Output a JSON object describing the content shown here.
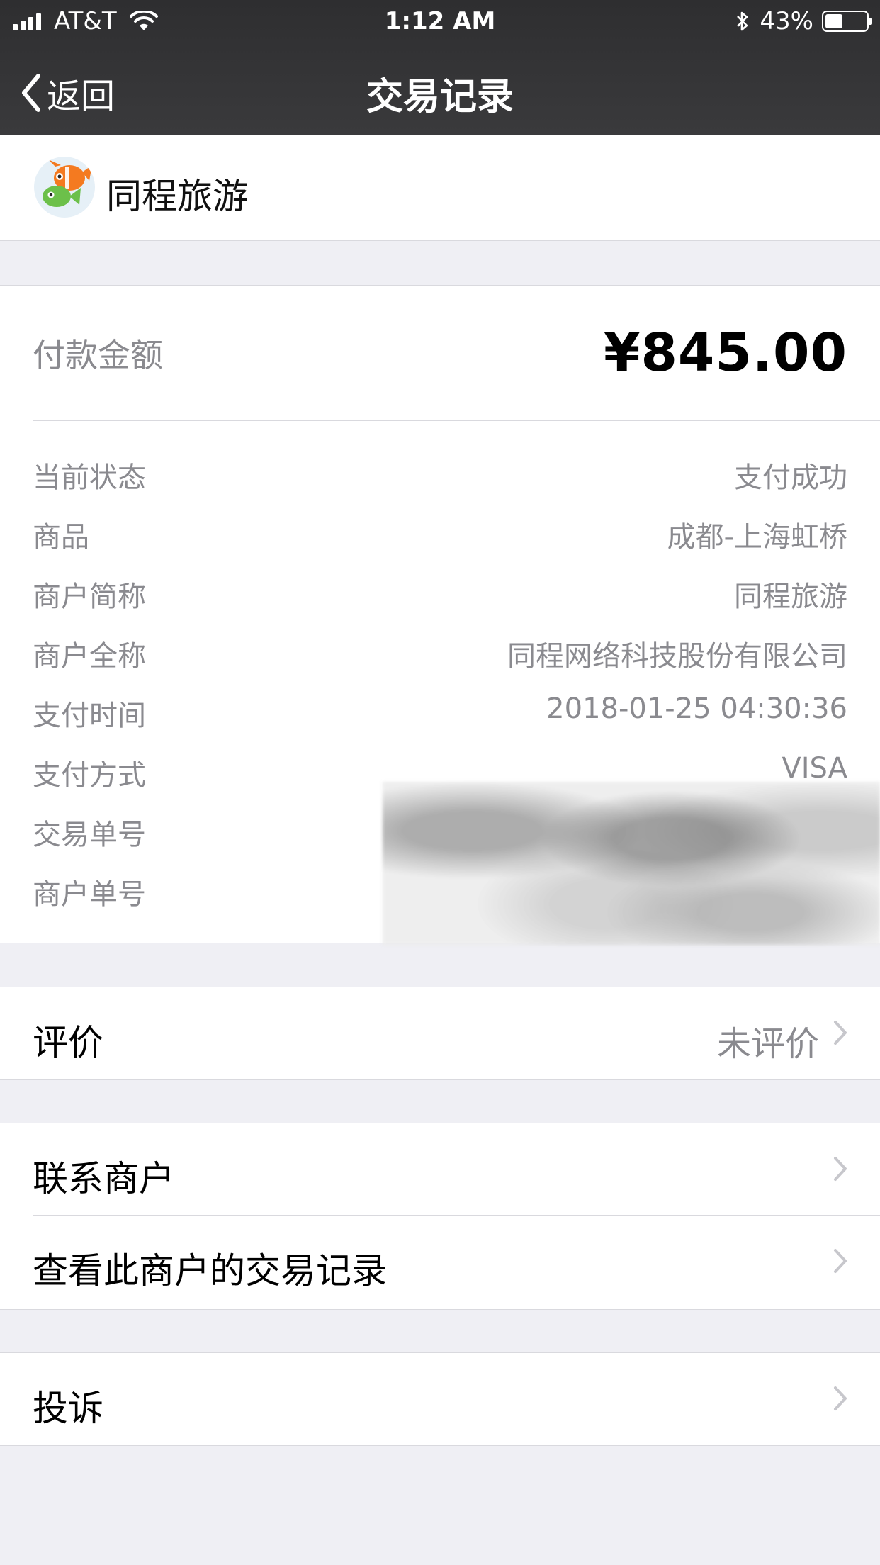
{
  "status_bar": {
    "carrier": "AT&T",
    "time": "1:12 AM",
    "battery": "43%",
    "battery_level": 0.43
  },
  "nav": {
    "back_label": "返回",
    "title": "交易记录"
  },
  "merchant": {
    "name": "同程旅游"
  },
  "payment": {
    "amount_label": "付款金额",
    "amount_value": "¥845.00",
    "rows": [
      {
        "key": "当前状态",
        "value": "支付成功"
      },
      {
        "key": "商品",
        "value": "成都-上海虹桥"
      },
      {
        "key": "商户简称",
        "value": "同程旅游"
      },
      {
        "key": "商户全称",
        "value": "同程网络科技股份有限公司"
      },
      {
        "key": "支付时间",
        "value": "2018-01-25 04:30:36"
      },
      {
        "key": "支付方式",
        "value": "VISA"
      },
      {
        "key": "交易单号",
        "value": ""
      },
      {
        "key": "商户单号",
        "value": ""
      }
    ]
  },
  "rating": {
    "label": "评价",
    "value": "未评价"
  },
  "actions": {
    "contact_label": "联系商户",
    "history_label": "查看此商户的交易记录"
  },
  "complaint": {
    "label": "投诉"
  }
}
